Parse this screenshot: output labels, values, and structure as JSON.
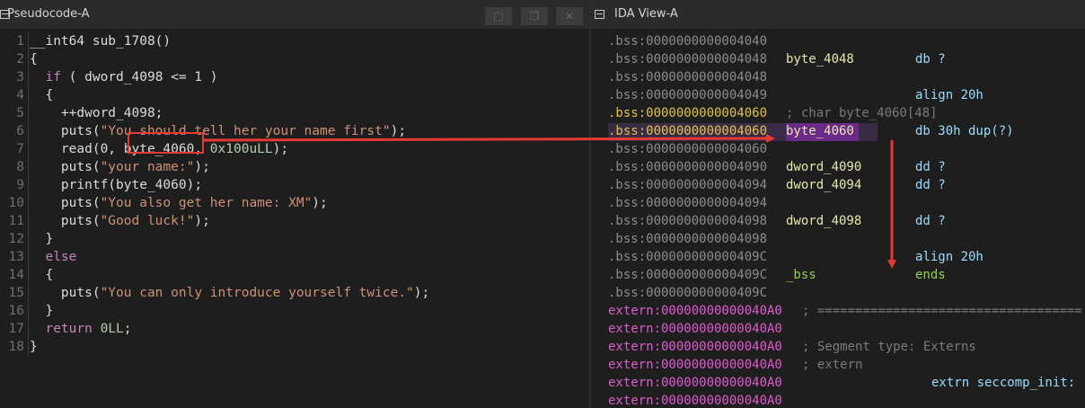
{
  "left_panel": {
    "title": "Pseudocode-A",
    "lines": [
      {
        "n": "1",
        "text": "__int64 sub_1708()"
      },
      {
        "n": "2",
        "text": "{"
      },
      {
        "n": "3",
        "text": "  if ( dword_4098 <= 1 )"
      },
      {
        "n": "4",
        "text": "  {"
      },
      {
        "n": "5",
        "text": "    ++dword_4098;"
      },
      {
        "n": "6",
        "text": "    puts(\"You should tell her your name first\");"
      },
      {
        "n": "7",
        "text": "    read(0, byte_4060, 0x100uLL);"
      },
      {
        "n": "8",
        "text": "    puts(\"your name:\");"
      },
      {
        "n": "9",
        "text": "    printf(byte_4060);"
      },
      {
        "n": "10",
        "text": "    puts(\"You also get her name: XM\");"
      },
      {
        "n": "11",
        "text": "    puts(\"Good luck!\");"
      },
      {
        "n": "12",
        "text": "  }"
      },
      {
        "n": "13",
        "text": "  else"
      },
      {
        "n": "14",
        "text": "  {"
      },
      {
        "n": "15",
        "text": "    puts(\"You can only introduce yourself twice.\");"
      },
      {
        "n": "16",
        "text": "  }"
      },
      {
        "n": "17",
        "text": "  return 0LL;"
      },
      {
        "n": "18",
        "text": "}"
      }
    ]
  },
  "right_panel": {
    "title": "IDA View-A",
    "lines": [
      {
        "addr": ".bss:0000000000004040",
        "label": "",
        "instr": "",
        "comment": ""
      },
      {
        "addr": ".bss:0000000000004048",
        "label": "byte_4048",
        "instr": "db ?",
        "comment": ""
      },
      {
        "addr": ".bss:0000000000004048",
        "label": "",
        "instr": "",
        "comment": ""
      },
      {
        "addr": ".bss:0000000000004049",
        "label": "",
        "instr": "align 20h",
        "comment": ""
      },
      {
        "addr": ".bss:0000000000004060",
        "label": "",
        "instr": "",
        "comment": "; char byte_4060[48]"
      },
      {
        "addr": ".bss:0000000000004060",
        "label": "byte_4060",
        "instr": "db 30h dup(?)",
        "comment": ""
      },
      {
        "addr": ".bss:0000000000004060",
        "label": "",
        "instr": "",
        "comment": ""
      },
      {
        "addr": ".bss:0000000000004090",
        "label": "dword_4090",
        "instr": "dd ?",
        "comment": ""
      },
      {
        "addr": ".bss:0000000000004094",
        "label": "dword_4094",
        "instr": "dd ?",
        "comment": ""
      },
      {
        "addr": ".bss:0000000000004094",
        "label": "",
        "instr": "",
        "comment": ""
      },
      {
        "addr": ".bss:0000000000004098",
        "label": "dword_4098",
        "instr": "dd ?",
        "comment": ""
      },
      {
        "addr": ".bss:0000000000004098",
        "label": "",
        "instr": "",
        "comment": ""
      },
      {
        "addr": ".bss:000000000000409C",
        "label": "",
        "instr": "align 20h",
        "comment": ""
      },
      {
        "addr": ".bss:000000000000409C",
        "label": "_bss",
        "instr": "ends",
        "comment": ""
      },
      {
        "addr": ".bss:000000000000409C",
        "label": "",
        "instr": "",
        "comment": ""
      },
      {
        "addr": "extern:00000000000040A0",
        "label": "",
        "instr": "",
        "comment": "; ==================================="
      },
      {
        "addr": "extern:00000000000040A0",
        "label": "",
        "instr": "",
        "comment": ""
      },
      {
        "addr": "extern:00000000000040A0",
        "label": "",
        "instr": "",
        "comment": "; Segment type: Externs"
      },
      {
        "addr": "extern:00000000000040A0",
        "label": "",
        "instr": "",
        "comment": "; extern"
      },
      {
        "addr": "extern:00000000000040A0",
        "label": "",
        "instr": "extrn seccomp_init:",
        "comment": ""
      },
      {
        "addr": "extern:00000000000040A0",
        "label": "",
        "instr": "",
        "comment": ""
      }
    ]
  },
  "colors": {
    "arrow": "#e53935",
    "highlight_label": "#6b2a88"
  }
}
